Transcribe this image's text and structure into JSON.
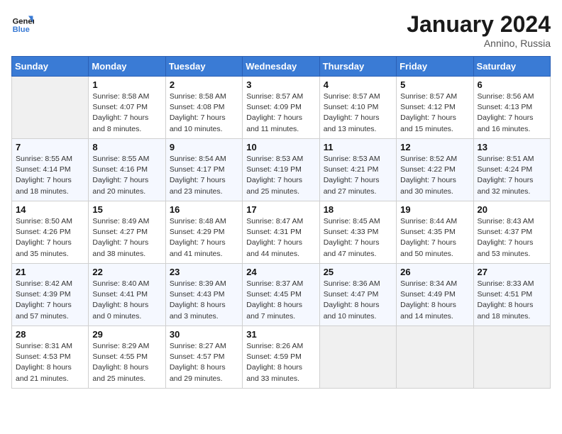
{
  "header": {
    "logo_line1": "General",
    "logo_line2": "Blue",
    "month": "January 2024",
    "location": "Annino, Russia"
  },
  "weekdays": [
    "Sunday",
    "Monday",
    "Tuesday",
    "Wednesday",
    "Thursday",
    "Friday",
    "Saturday"
  ],
  "weeks": [
    [
      {
        "day": "",
        "info": ""
      },
      {
        "day": "1",
        "info": "Sunrise: 8:58 AM\nSunset: 4:07 PM\nDaylight: 7 hours\nand 8 minutes."
      },
      {
        "day": "2",
        "info": "Sunrise: 8:58 AM\nSunset: 4:08 PM\nDaylight: 7 hours\nand 10 minutes."
      },
      {
        "day": "3",
        "info": "Sunrise: 8:57 AM\nSunset: 4:09 PM\nDaylight: 7 hours\nand 11 minutes."
      },
      {
        "day": "4",
        "info": "Sunrise: 8:57 AM\nSunset: 4:10 PM\nDaylight: 7 hours\nand 13 minutes."
      },
      {
        "day": "5",
        "info": "Sunrise: 8:57 AM\nSunset: 4:12 PM\nDaylight: 7 hours\nand 15 minutes."
      },
      {
        "day": "6",
        "info": "Sunrise: 8:56 AM\nSunset: 4:13 PM\nDaylight: 7 hours\nand 16 minutes."
      }
    ],
    [
      {
        "day": "7",
        "info": "Sunrise: 8:55 AM\nSunset: 4:14 PM\nDaylight: 7 hours\nand 18 minutes."
      },
      {
        "day": "8",
        "info": "Sunrise: 8:55 AM\nSunset: 4:16 PM\nDaylight: 7 hours\nand 20 minutes."
      },
      {
        "day": "9",
        "info": "Sunrise: 8:54 AM\nSunset: 4:17 PM\nDaylight: 7 hours\nand 23 minutes."
      },
      {
        "day": "10",
        "info": "Sunrise: 8:53 AM\nSunset: 4:19 PM\nDaylight: 7 hours\nand 25 minutes."
      },
      {
        "day": "11",
        "info": "Sunrise: 8:53 AM\nSunset: 4:21 PM\nDaylight: 7 hours\nand 27 minutes."
      },
      {
        "day": "12",
        "info": "Sunrise: 8:52 AM\nSunset: 4:22 PM\nDaylight: 7 hours\nand 30 minutes."
      },
      {
        "day": "13",
        "info": "Sunrise: 8:51 AM\nSunset: 4:24 PM\nDaylight: 7 hours\nand 32 minutes."
      }
    ],
    [
      {
        "day": "14",
        "info": "Sunrise: 8:50 AM\nSunset: 4:26 PM\nDaylight: 7 hours\nand 35 minutes."
      },
      {
        "day": "15",
        "info": "Sunrise: 8:49 AM\nSunset: 4:27 PM\nDaylight: 7 hours\nand 38 minutes."
      },
      {
        "day": "16",
        "info": "Sunrise: 8:48 AM\nSunset: 4:29 PM\nDaylight: 7 hours\nand 41 minutes."
      },
      {
        "day": "17",
        "info": "Sunrise: 8:47 AM\nSunset: 4:31 PM\nDaylight: 7 hours\nand 44 minutes."
      },
      {
        "day": "18",
        "info": "Sunrise: 8:45 AM\nSunset: 4:33 PM\nDaylight: 7 hours\nand 47 minutes."
      },
      {
        "day": "19",
        "info": "Sunrise: 8:44 AM\nSunset: 4:35 PM\nDaylight: 7 hours\nand 50 minutes."
      },
      {
        "day": "20",
        "info": "Sunrise: 8:43 AM\nSunset: 4:37 PM\nDaylight: 7 hours\nand 53 minutes."
      }
    ],
    [
      {
        "day": "21",
        "info": "Sunrise: 8:42 AM\nSunset: 4:39 PM\nDaylight: 7 hours\nand 57 minutes."
      },
      {
        "day": "22",
        "info": "Sunrise: 8:40 AM\nSunset: 4:41 PM\nDaylight: 8 hours\nand 0 minutes."
      },
      {
        "day": "23",
        "info": "Sunrise: 8:39 AM\nSunset: 4:43 PM\nDaylight: 8 hours\nand 3 minutes."
      },
      {
        "day": "24",
        "info": "Sunrise: 8:37 AM\nSunset: 4:45 PM\nDaylight: 8 hours\nand 7 minutes."
      },
      {
        "day": "25",
        "info": "Sunrise: 8:36 AM\nSunset: 4:47 PM\nDaylight: 8 hours\nand 10 minutes."
      },
      {
        "day": "26",
        "info": "Sunrise: 8:34 AM\nSunset: 4:49 PM\nDaylight: 8 hours\nand 14 minutes."
      },
      {
        "day": "27",
        "info": "Sunrise: 8:33 AM\nSunset: 4:51 PM\nDaylight: 8 hours\nand 18 minutes."
      }
    ],
    [
      {
        "day": "28",
        "info": "Sunrise: 8:31 AM\nSunset: 4:53 PM\nDaylight: 8 hours\nand 21 minutes."
      },
      {
        "day": "29",
        "info": "Sunrise: 8:29 AM\nSunset: 4:55 PM\nDaylight: 8 hours\nand 25 minutes."
      },
      {
        "day": "30",
        "info": "Sunrise: 8:27 AM\nSunset: 4:57 PM\nDaylight: 8 hours\nand 29 minutes."
      },
      {
        "day": "31",
        "info": "Sunrise: 8:26 AM\nSunset: 4:59 PM\nDaylight: 8 hours\nand 33 minutes."
      },
      {
        "day": "",
        "info": ""
      },
      {
        "day": "",
        "info": ""
      },
      {
        "day": "",
        "info": ""
      }
    ]
  ]
}
